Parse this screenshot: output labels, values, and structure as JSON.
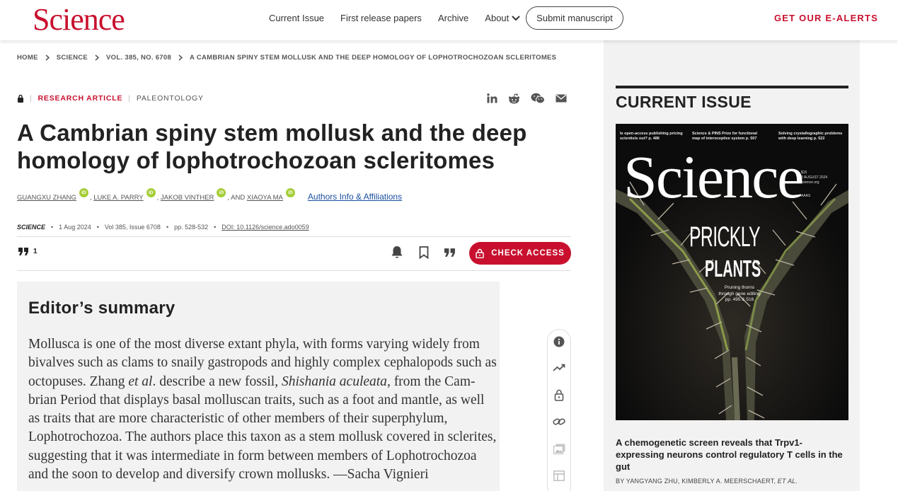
{
  "header": {
    "logo": "Science",
    "nav": [
      "Current Issue",
      "First release papers",
      "Archive"
    ],
    "about": "About",
    "submit": "Submit manuscript",
    "alerts": "GET OUR E-ALERTS"
  },
  "breadcrumb": [
    "HOME",
    "SCIENCE",
    "VOL. 385, NO. 6708",
    "A CAMBRIAN SPINY STEM MOLLUSK AND THE DEEP HOMOLOGY OF LOPHOTROCHOZOAN SCLERITOMES"
  ],
  "article": {
    "type": "RESEARCH ARTICLE",
    "subject": "PALEONTOLOGY",
    "title": "A Cambrian spiny stem mollusk and the deep homology of lophotrochozoan scleritomes",
    "authors": [
      "GUANGXU ZHANG",
      "LUKE A. PARRY",
      "JAKOB VINTHER",
      "XIAOYA MA"
    ],
    "author_sep": ", ",
    "author_and": ", AND ",
    "orcid": "iD",
    "affiliations": "Authors Info & Affiliations",
    "journal": "SCIENCE",
    "date": "1 Aug 2024",
    "volume": "Vol 385, Issue 6708",
    "pages": "pp. 528-532",
    "doi": "DOI: 10.1126/science.ado0059",
    "citations": "1",
    "check_access": "CHECK ACCESS"
  },
  "summary": {
    "heading": "Editor’s summary",
    "p1": "Mollusca is one of the most diverse extant phyla, with forms varying widely from bivalves such as clams to snaily gastropods and highly complex cephalopods such as octopuses. Zhang ",
    "etal": "et al",
    "p2": ". describe a new fossil, ",
    "species": "Shishania aculeata",
    "p3": ", from the Cam­brian Period that displays basal molluscan traits, such as a foot and mantle, as well as traits that are more characteristic of other members of their superphylum, Lophotrochozoa. The authors place this taxon as a stem mollusk covered in scle­rites, suggesting that it was intermediate in form between members of Lophotro­chozoa and the soon to develop and diversify crown mollusks. —Sacha Vignieri"
  },
  "sidebar": {
    "heading": "CURRENT ISSUE",
    "cover": {
      "teaser1": "Is open-access publishing pricing scientists out? p. 486",
      "teaser2": "Science & PINS Prize for functional map of interoceptive system p. 507",
      "teaser3": "Solving crystallographic problems with deep learning p. 522",
      "logo": "Science",
      "price": "$15",
      "date": "2 AUGUST 2024",
      "site": "science.org",
      "aaas": "AAAS",
      "headline1": "PRICKLY",
      "headline2": "PLANTS",
      "subline": "Pruning thorns through gene editing pp. 495 & 516"
    },
    "article_title": "A chemogenetic screen reveals that Trpv1-expressing neurons control regulatory T cells in the gut",
    "byline_prefix": "BY YANGYANG ZHU, KIMBERLY A. MEERSCHAERT, ",
    "byline_etal": "ET AL."
  }
}
